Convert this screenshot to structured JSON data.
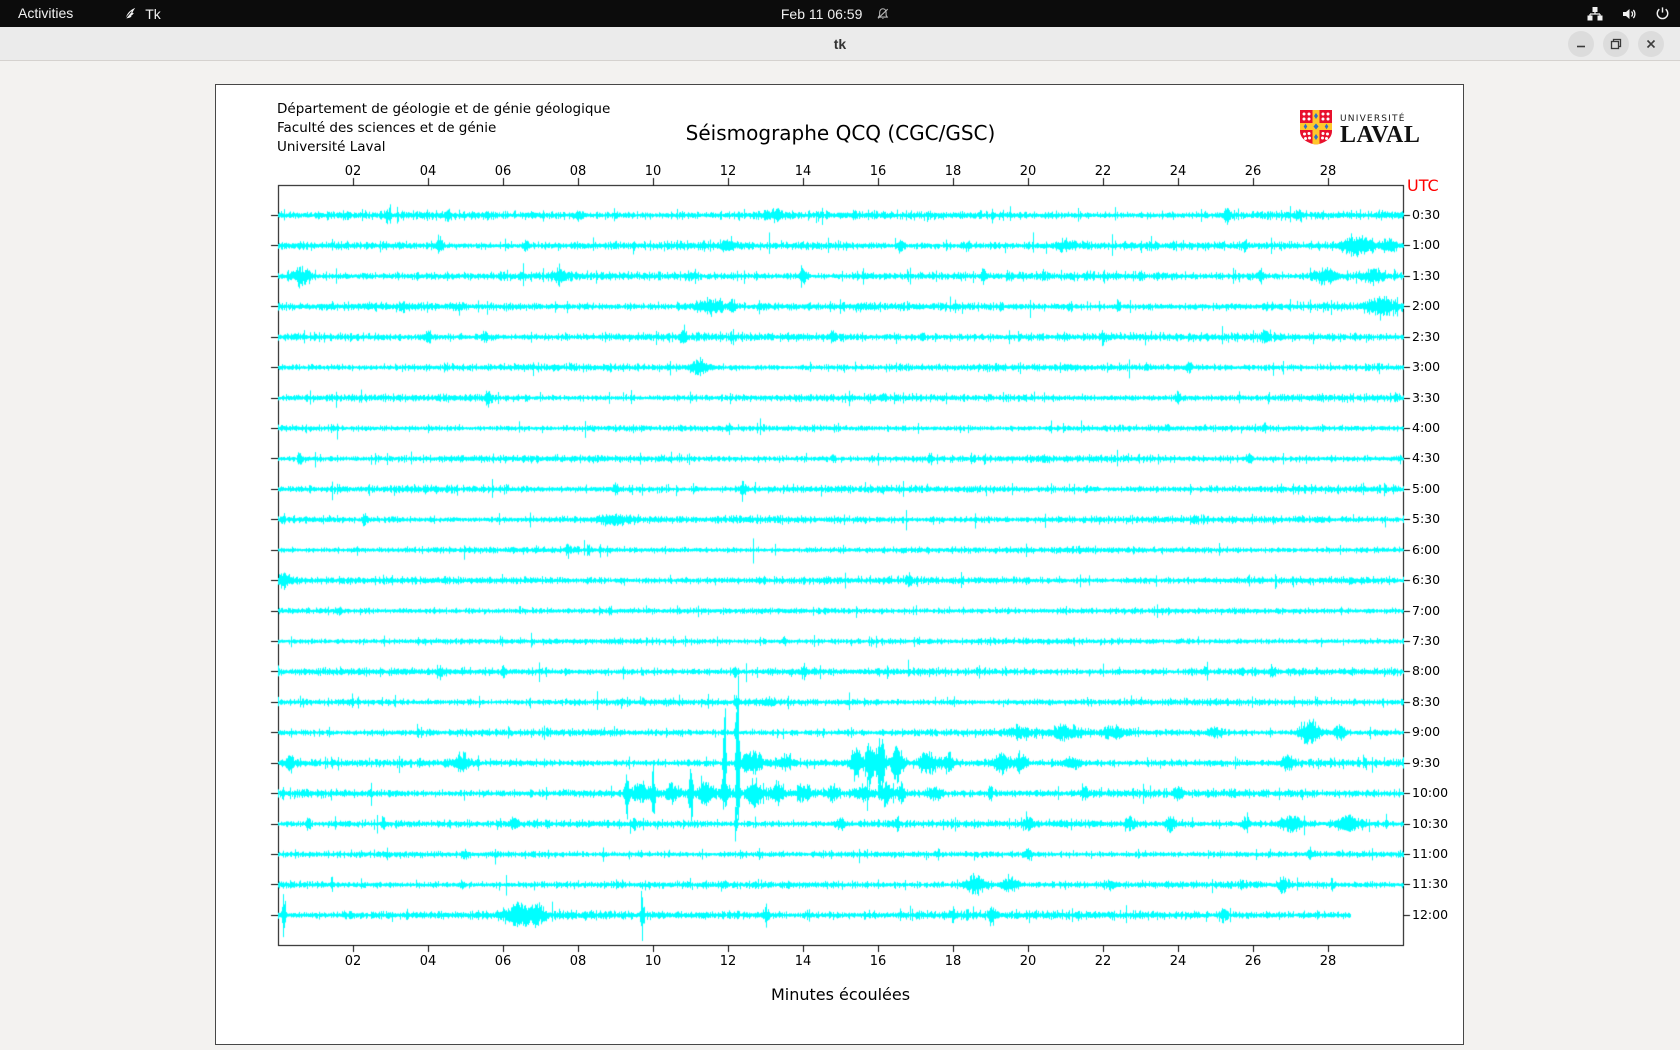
{
  "topbar": {
    "activities_label": "Activities",
    "app_name": "Tk",
    "clock": "Feb 11 06:59"
  },
  "window": {
    "title": "tk"
  },
  "seismograph": {
    "header_lines": [
      "Département de géologie et de génie géologique",
      "Faculté des sciences et de génie",
      "Université Laval"
    ],
    "title": "Séismographe QCQ (CGC/GSC)",
    "logo": {
      "line1": "UNIVERSITÉ",
      "line2": "LAVAL",
      "shield_red": "#e8112d",
      "shield_yellow": "#ffc72c",
      "shield_blue": "#2a6fc9"
    },
    "utc_label": "UTC",
    "utc_color": "#ff0000",
    "xlabel": "Minutes écoulées",
    "trace_color": "#00ffff",
    "chart_data": {
      "type": "line",
      "x_range_minutes": [
        0,
        30
      ],
      "x_tick_labels": [
        "02",
        "04",
        "06",
        "08",
        "10",
        "12",
        "14",
        "16",
        "18",
        "20",
        "22",
        "24",
        "26",
        "28"
      ],
      "row_labels": [
        "0:30",
        "1:00",
        "1:30",
        "2:00",
        "2:30",
        "3:00",
        "3:30",
        "4:00",
        "4:30",
        "5:00",
        "5:30",
        "6:00",
        "6:30",
        "7:00",
        "7:30",
        "8:00",
        "8:30",
        "9:00",
        "9:30",
        "10:00",
        "10:30",
        "11:00",
        "11:30",
        "12:00"
      ],
      "rows": [
        {
          "label": "0:30",
          "base": 1.15,
          "events": [
            [
              2.9,
              0.06,
              5
            ],
            [
              4.5,
              0.05,
              4
            ],
            [
              8.0,
              0.1,
              3
            ],
            [
              13.2,
              0.3,
              3
            ],
            [
              25.3,
              0.08,
              6
            ],
            [
              27.2,
              0.1,
              3
            ]
          ]
        },
        {
          "label": "1:00",
          "base": 1.15,
          "events": [
            [
              4.3,
              0.1,
              6
            ],
            [
              6.6,
              0.08,
              3
            ],
            [
              12.0,
              0.2,
              3
            ],
            [
              16.6,
              0.06,
              5
            ],
            [
              18.4,
              0.05,
              4
            ],
            [
              21.0,
              0.3,
              3
            ],
            [
              25.8,
              0.05,
              4
            ],
            [
              28.8,
              0.4,
              7
            ],
            [
              29.6,
              0.2,
              5
            ]
          ]
        },
        {
          "label": "1:30",
          "base": 1.15,
          "events": [
            [
              0.6,
              0.25,
              6
            ],
            [
              7.5,
              0.12,
              6
            ],
            [
              11.0,
              0.1,
              3
            ],
            [
              14.0,
              0.08,
              6
            ],
            [
              15.6,
              0.05,
              4
            ],
            [
              18.8,
              0.06,
              5
            ],
            [
              20.4,
              0.05,
              5
            ],
            [
              23.0,
              0.06,
              4
            ],
            [
              26.2,
              0.08,
              5
            ],
            [
              27.9,
              0.3,
              6
            ],
            [
              29.2,
              0.3,
              5
            ]
          ]
        },
        {
          "label": "2:00",
          "base": 1.15,
          "events": [
            [
              3.3,
              0.1,
              3
            ],
            [
              11.5,
              0.35,
              5
            ],
            [
              12.1,
              0.08,
              5
            ],
            [
              22.4,
              0.06,
              4
            ],
            [
              29.4,
              0.35,
              7
            ]
          ]
        },
        {
          "label": "2:30",
          "base": 1.15,
          "events": [
            [
              4.0,
              0.07,
              4
            ],
            [
              5.5,
              0.1,
              4
            ],
            [
              10.8,
              0.1,
              4
            ],
            [
              14.8,
              0.07,
              4
            ],
            [
              22.0,
              0.06,
              4
            ],
            [
              26.3,
              0.12,
              5
            ]
          ]
        },
        {
          "label": "3:00",
          "base": 1.0,
          "events": [
            [
              11.2,
              0.25,
              5
            ],
            [
              24.3,
              0.07,
              4
            ]
          ]
        },
        {
          "label": "3:30",
          "base": 1.0,
          "events": [
            [
              5.6,
              0.08,
              5
            ],
            [
              24.0,
              0.06,
              4
            ]
          ]
        },
        {
          "label": "4:00",
          "base": 0.85,
          "events": [
            [
              26.3,
              0.05,
              3
            ]
          ]
        },
        {
          "label": "4:30",
          "base": 1.0,
          "events": [
            [
              0.6,
              0.06,
              4
            ],
            [
              14.8,
              0.06,
              4
            ],
            [
              17.4,
              0.05,
              3
            ],
            [
              25.9,
              0.06,
              4
            ]
          ]
        },
        {
          "label": "5:00",
          "base": 1.0,
          "events": [
            [
              9.0,
              0.08,
              4
            ],
            [
              12.4,
              0.1,
              5
            ]
          ]
        },
        {
          "label": "5:30",
          "base": 1.0,
          "events": [
            [
              2.3,
              0.06,
              4
            ],
            [
              9.0,
              0.5,
              3
            ]
          ]
        },
        {
          "label": "6:00",
          "base": 0.9,
          "events": [
            [
              7.7,
              0.06,
              4
            ]
          ]
        },
        {
          "label": "6:30",
          "base": 1.0,
          "events": [
            [
              0.15,
              0.15,
              6
            ],
            [
              16.8,
              0.1,
              3
            ]
          ]
        },
        {
          "label": "7:00",
          "base": 0.85,
          "events": [
            [
              1.6,
              0.08,
              3
            ]
          ]
        },
        {
          "label": "7:30",
          "base": 0.85,
          "events": [
            [
              13.5,
              0.06,
              3
            ]
          ]
        },
        {
          "label": "8:00",
          "base": 1.05,
          "events": [
            [
              4.3,
              0.06,
              5
            ],
            [
              6.0,
              0.06,
              5
            ],
            [
              12.2,
              0.05,
              4
            ],
            [
              14.0,
              0.07,
              4
            ],
            [
              24.7,
              0.06,
              3
            ],
            [
              26.5,
              0.06,
              5
            ]
          ]
        },
        {
          "label": "8:30",
          "base": 0.95,
          "events": [
            [
              12.2,
              0.04,
              6
            ],
            [
              13.1,
              0.15,
              3
            ]
          ]
        },
        {
          "label": "9:00",
          "base": 1.0,
          "events": [
            [
              12.2,
              0.03,
              10
            ],
            [
              19.8,
              0.3,
              4
            ],
            [
              21.0,
              0.4,
              5
            ],
            [
              22.3,
              0.3,
              4
            ],
            [
              25.0,
              0.2,
              3
            ],
            [
              27.5,
              0.25,
              10
            ],
            [
              28.3,
              0.15,
              6
            ]
          ]
        },
        {
          "label": "9:30",
          "base": 1.1,
          "events": [
            [
              0.3,
              0.1,
              5
            ],
            [
              4.9,
              0.2,
              7
            ],
            [
              11.9,
              0.035,
              62
            ],
            [
              12.25,
              0.04,
              88
            ],
            [
              12.6,
              0.3,
              8
            ],
            [
              13.5,
              0.2,
              5
            ],
            [
              15.4,
              0.12,
              16
            ],
            [
              15.75,
              0.1,
              22
            ],
            [
              16.05,
              0.12,
              24
            ],
            [
              16.5,
              0.15,
              16
            ],
            [
              17.3,
              0.2,
              10
            ],
            [
              17.85,
              0.15,
              8
            ],
            [
              19.3,
              0.2,
              9
            ],
            [
              19.8,
              0.15,
              7
            ],
            [
              21.2,
              0.2,
              5
            ],
            [
              26.9,
              0.15,
              6
            ]
          ]
        },
        {
          "label": "10:00",
          "base": 1.15,
          "events": [
            [
              9.3,
              0.05,
              26
            ],
            [
              9.65,
              0.2,
              8
            ],
            [
              10.0,
              0.05,
              22
            ],
            [
              10.5,
              0.15,
              8
            ],
            [
              11.0,
              0.05,
              30
            ],
            [
              11.4,
              0.2,
              10
            ],
            [
              11.9,
              0.1,
              12
            ],
            [
              12.25,
              0.05,
              28
            ],
            [
              12.7,
              0.2,
              10
            ],
            [
              13.3,
              0.15,
              8
            ],
            [
              14.0,
              0.2,
              6
            ],
            [
              14.8,
              0.15,
              6
            ],
            [
              15.6,
              0.2,
              7
            ],
            [
              16.2,
              0.15,
              9
            ],
            [
              16.6,
              0.1,
              8
            ],
            [
              17.5,
              0.2,
              5
            ],
            [
              19.0,
              0.05,
              7
            ],
            [
              21.5,
              0.1,
              4
            ],
            [
              24.0,
              0.1,
              4
            ]
          ]
        },
        {
          "label": "10:30",
          "base": 1.05,
          "events": [
            [
              0.8,
              0.06,
              4
            ],
            [
              2.8,
              0.06,
              4
            ],
            [
              6.3,
              0.08,
              4
            ],
            [
              9.5,
              0.06,
              4
            ],
            [
              12.2,
              0.03,
              16
            ],
            [
              15.0,
              0.1,
              5
            ],
            [
              16.5,
              0.08,
              4
            ],
            [
              20.0,
              0.12,
              5
            ],
            [
              22.7,
              0.1,
              5
            ],
            [
              23.8,
              0.12,
              6
            ],
            [
              25.8,
              0.1,
              5
            ],
            [
              27.0,
              0.3,
              6
            ],
            [
              28.5,
              0.3,
              6
            ]
          ]
        },
        {
          "label": "11:00",
          "base": 0.9,
          "events": [
            [
              5.0,
              0.06,
              3
            ],
            [
              20.0,
              0.1,
              4
            ],
            [
              27.5,
              0.06,
              3
            ]
          ]
        },
        {
          "label": "11:30",
          "base": 1.0,
          "events": [
            [
              4.9,
              0.06,
              3
            ],
            [
              18.6,
              0.25,
              8
            ],
            [
              19.5,
              0.2,
              6
            ],
            [
              22.2,
              0.1,
              4
            ],
            [
              26.8,
              0.15,
              5
            ]
          ]
        },
        {
          "label": "12:00",
          "base": 1.25,
          "end_min": 28.6,
          "events": [
            [
              0.15,
              0.04,
              22
            ],
            [
              6.4,
              0.3,
              9
            ],
            [
              6.9,
              0.2,
              7
            ],
            [
              9.7,
              0.04,
              20
            ],
            [
              13.0,
              0.1,
              4
            ],
            [
              18.0,
              0.1,
              3
            ],
            [
              19.0,
              0.08,
              4
            ],
            [
              25.2,
              0.1,
              4
            ]
          ]
        }
      ]
    }
  }
}
